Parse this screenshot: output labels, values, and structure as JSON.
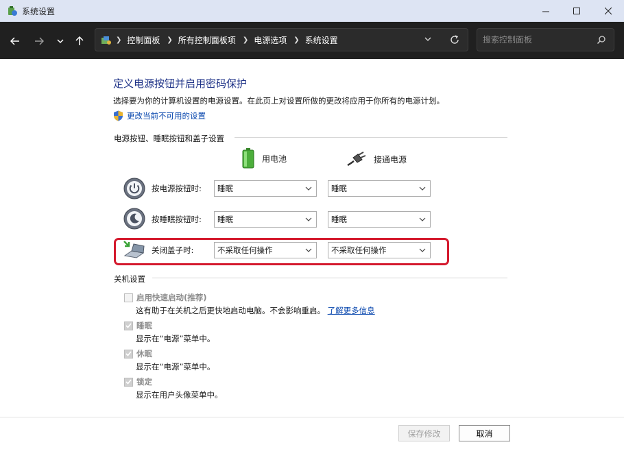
{
  "window": {
    "title": "系统设置"
  },
  "nav": {
    "breadcrumbs": [
      "控制面板",
      "所有控制面板项",
      "电源选项",
      "系统设置"
    ],
    "search_placeholder": "搜索控制面板"
  },
  "page": {
    "heading": "定义电源按钮并启用密码保护",
    "description": "选择要为你的计算机设置的电源设置。在此页上对设置所做的更改将应用于你所有的电源计划。",
    "change_link": "更改当前不可用的设置"
  },
  "power_section": {
    "label": "电源按钮、睡眠按钮和盖子设置",
    "col_battery": "用电池",
    "col_plugged": "接通电源",
    "rows": [
      {
        "label": "按电源按钮时:",
        "battery": "睡眠",
        "plugged": "睡眠"
      },
      {
        "label": "按睡眠按钮时:",
        "battery": "睡眠",
        "plugged": "睡眠"
      },
      {
        "label": "关闭盖子时:",
        "battery": "不采取任何操作",
        "plugged": "不采取任何操作"
      }
    ],
    "highlight_color": "#d4192d"
  },
  "shutdown_section": {
    "label": "关机设置",
    "items": [
      {
        "label": "启用快速启动(推荐)",
        "checked": false,
        "desc": "这有助于在关机之后更快地启动电脑。不会影响重启。",
        "link": "了解更多信息"
      },
      {
        "label": "睡眠",
        "checked": true,
        "desc": "显示在“电源”菜单中。"
      },
      {
        "label": "休眠",
        "checked": true,
        "desc": "显示在“电源”菜单中。"
      },
      {
        "label": "锁定",
        "checked": true,
        "desc": "显示在用户头像菜单中。"
      }
    ]
  },
  "footer": {
    "save": "保存修改",
    "cancel": "取消"
  }
}
